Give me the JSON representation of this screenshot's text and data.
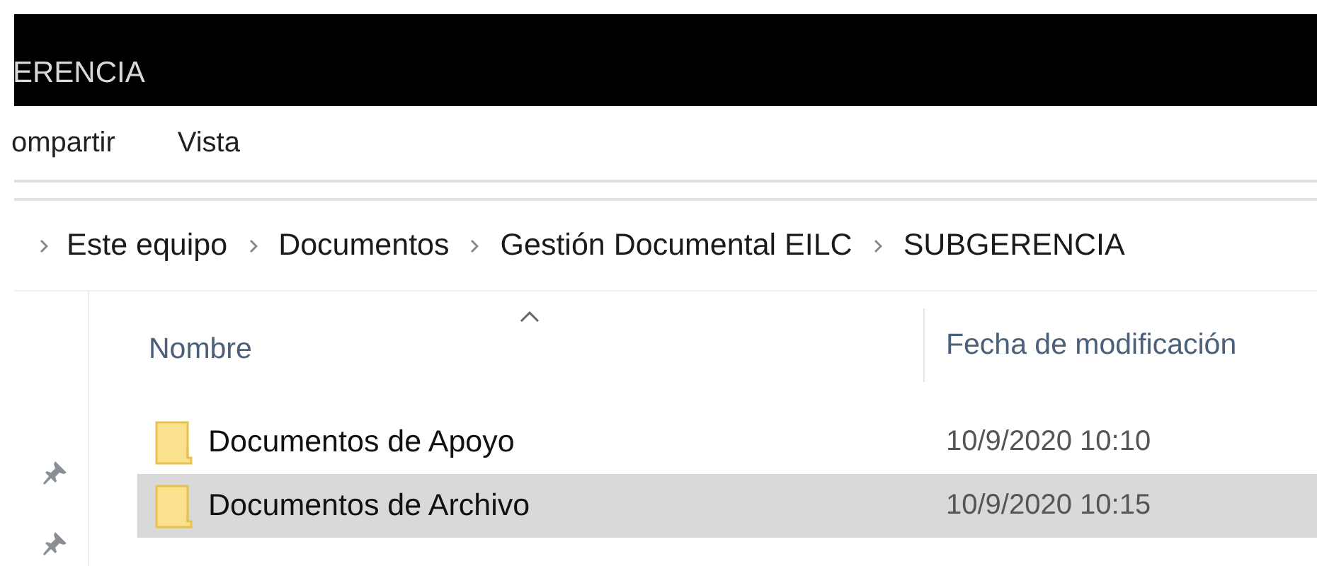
{
  "window": {
    "title": "ERENCIA"
  },
  "ribbon_tabs": [
    {
      "label": "ompartir"
    },
    {
      "label": "Vista"
    }
  ],
  "breadcrumb": [
    "Este equipo",
    "Documentos",
    "Gestión Documental EILC",
    "SUBGERENCIA"
  ],
  "quick_access": [
    {
      "pinned": true
    },
    {
      "pinned": true
    }
  ],
  "columns": [
    {
      "label": "Nombre",
      "sorted": true
    },
    {
      "label": "Fecha de modificación",
      "sorted": false
    }
  ],
  "rows": [
    {
      "kind": "folder",
      "name": "Documentos de Apoyo",
      "date": "10/9/2020 10:10",
      "selected": false
    },
    {
      "kind": "folder",
      "name": "Documentos de Archivo",
      "date": "10/9/2020 10:15",
      "selected": true
    }
  ]
}
